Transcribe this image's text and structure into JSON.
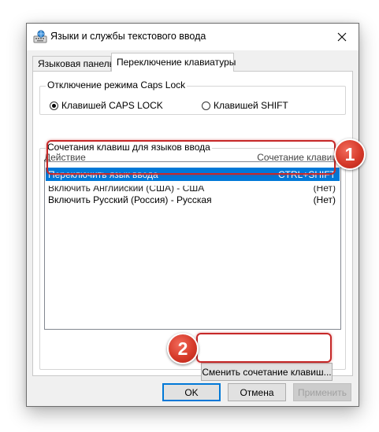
{
  "window": {
    "title": "Языки и службы текстового ввода"
  },
  "tabs": [
    {
      "label": "Языковая панель",
      "active": false
    },
    {
      "label": "Переключение клавиатуры",
      "active": true
    }
  ],
  "caps_lock_group": {
    "legend": "Отключение режима Caps Lock",
    "options": [
      {
        "label": "Клавишей CAPS LOCK",
        "selected": true
      },
      {
        "label": "Клавишей SHIFT",
        "selected": false
      }
    ]
  },
  "hotkeys_group": {
    "legend": "Сочетания клавиш для языков ввода",
    "columns": {
      "action": "Действие",
      "combo": "Сочетание клавиш"
    },
    "rows": [
      {
        "action": "Переключить язык ввода",
        "combo": "CTRL+SHIFT",
        "selected": true
      },
      {
        "action": "Включить Английский (США) - США",
        "combo": "(Нет)",
        "selected": false
      },
      {
        "action": "Включить Русский (Россия) - Русская",
        "combo": "(Нет)",
        "selected": false
      }
    ],
    "change_button": "Сменить сочетание клавиш..."
  },
  "badges": [
    "1",
    "2"
  ],
  "footer": {
    "ok": "OK",
    "cancel": "Отмена",
    "apply": "Применить"
  },
  "colors": {
    "selection": "#0078d7",
    "callout": "#c62828",
    "badge": "#d63a2a"
  },
  "icons": {
    "app": "keyboard-languages-icon",
    "close": "close-icon"
  }
}
